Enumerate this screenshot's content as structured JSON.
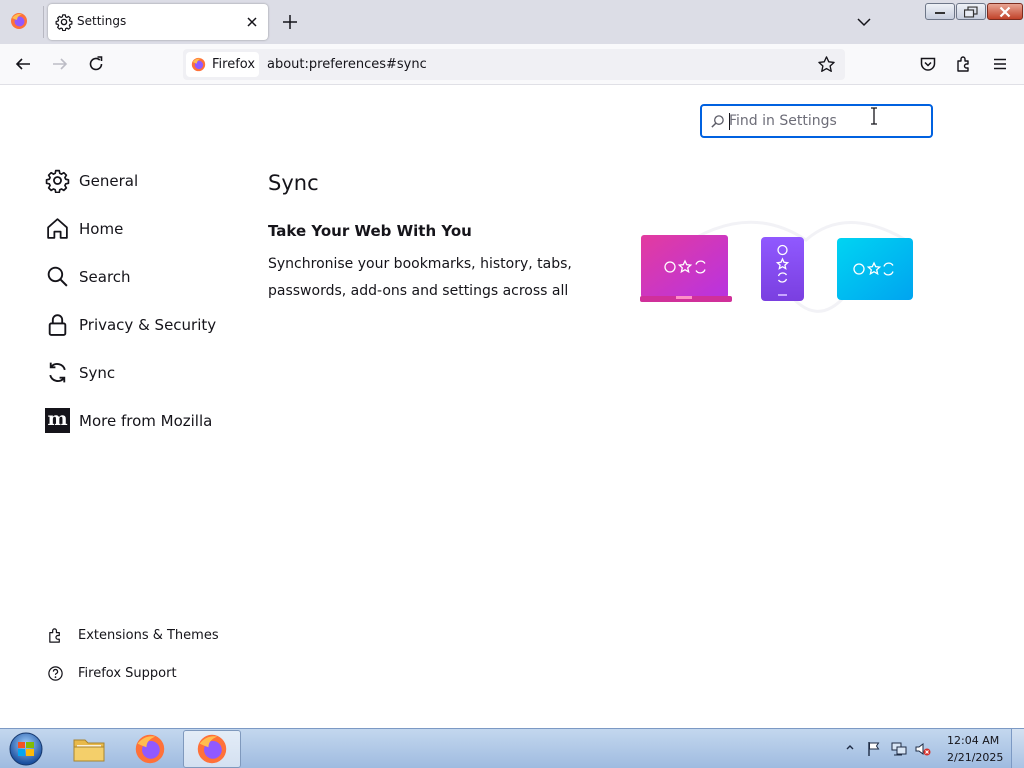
{
  "browser": {
    "tab": {
      "title": "Settings"
    },
    "identity_label": "Firefox",
    "url": "about:preferences#sync"
  },
  "search": {
    "placeholder": "Find in Settings",
    "value": ""
  },
  "categories": [
    {
      "label": "General",
      "icon": "gear-icon"
    },
    {
      "label": "Home",
      "icon": "home-icon"
    },
    {
      "label": "Search",
      "icon": "search-icon"
    },
    {
      "label": "Privacy & Security",
      "icon": "lock-icon"
    },
    {
      "label": "Sync",
      "icon": "sync-icon"
    },
    {
      "label": "More from Mozilla",
      "icon": "mozilla-logo-icon"
    }
  ],
  "footer_links": [
    {
      "label": "Extensions & Themes",
      "icon": "puzzle-icon"
    },
    {
      "label": "Firefox Support",
      "icon": "help-icon"
    }
  ],
  "pane": {
    "title": "Sync",
    "heading": "Take Your Web With You",
    "description_line1": "Synchronise your bookmarks, history, tabs,",
    "description_line2": "passwords, add-ons and settings across all"
  },
  "taskbar": {
    "time": "12:04 AM",
    "date": "2/21/2025"
  },
  "colors": {
    "accent": "#0061e0",
    "laptop": "#e0409f",
    "phone": "#9059ff",
    "tablet": "#00c8ee"
  }
}
